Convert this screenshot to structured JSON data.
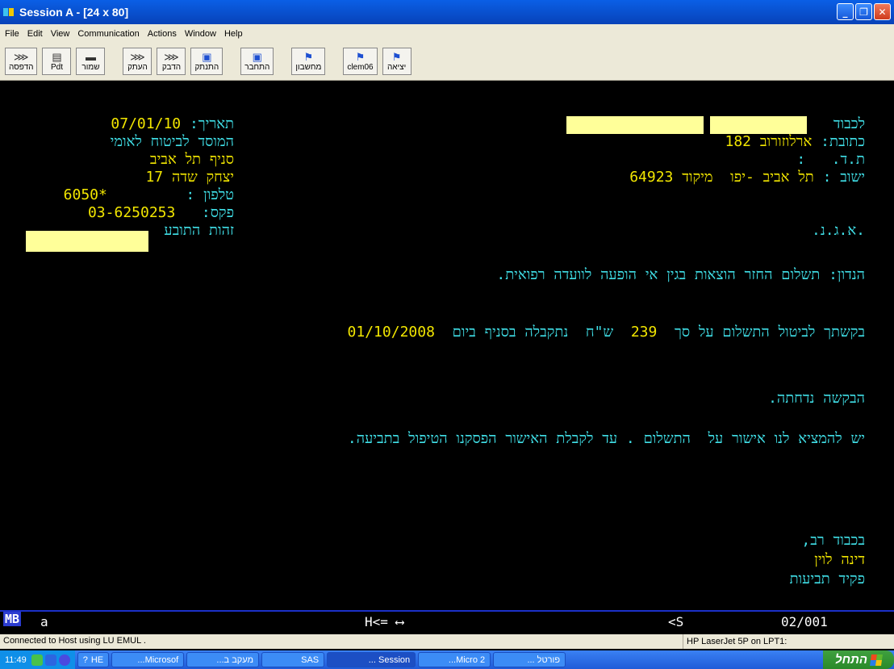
{
  "window": {
    "title": "Session A - [24 x 80]",
    "controls": {
      "minimize": "_",
      "maximize": "❐",
      "close": "✕"
    }
  },
  "menu": [
    "File",
    "Edit",
    "View",
    "Communication",
    "Actions",
    "Window",
    "Help"
  ],
  "toolbar": [
    {
      "label": "הדפסה",
      "icon": "print-screen-icon"
    },
    {
      "label": "Pdt",
      "icon": "pdt-icon"
    },
    {
      "label": "שמור",
      "icon": "save-icon"
    },
    {
      "label": "העתק",
      "icon": "copy-icon"
    },
    {
      "label": "הדבק",
      "icon": "paste-icon"
    },
    {
      "label": "התנתק",
      "icon": "disconnect-icon"
    },
    {
      "label": "התחבר",
      "icon": "connect-icon"
    },
    {
      "label": "מחשבון",
      "icon": "calculator-icon"
    },
    {
      "label": "clem06",
      "icon": "clem06-icon"
    },
    {
      "label": "יציאה",
      "icon": "exit-icon"
    }
  ],
  "letter": {
    "to_label": "לכבוד",
    "address_label": "כתובת:",
    "address_value": "ארלוזורוב 182",
    "po_box": "ת.ד.   :",
    "city_label": "ישוב :",
    "city_value": "תל אביב -יפו  מיקוד 64923",
    "ank": ".א.ג.נ.",
    "date_label": "תאריך:",
    "date_value": "07/01/10",
    "institute": "המוסד לביטוח לאומי",
    "branch": "סניף תל אביב",
    "branch_address": "יצחק שדה 17",
    "phone_label": "טלפון :",
    "phone_value": "*6050",
    "fax_label": "פקס:",
    "fax_value": "03-6250253",
    "claimant_id_label": "זהות התובע",
    "subject": "הנדון: תשלום החזר הוצאות בגין אי הופעה לוועדה רפואית.",
    "request_part1": "בקשתך לביטול התשלום על סך",
    "amount": "239",
    "request_part2": "ש\"ח  נתקבלה בסניף ביום",
    "received_date": "01/10/2008",
    "rejected": "הבקשה נדחתה.",
    "instruction": "יש להמציא לנו אישור על  התשלום . עד לקבלת האישור הפסקנו הטיפול בתביעה.",
    "closing": "בכבוד רב,",
    "signer_name": "דינה לוין",
    "signer_title": "פקיד תביעות"
  },
  "oia": {
    "mode": "MB",
    "session": "a",
    "cursor_dir": "H<= ⟷",
    "indicator": "<S",
    "position": "02/001"
  },
  "status": {
    "connection": "Connected to Host using LU EMUL   .",
    "printer": "HP LaserJet 5P on LPT1:"
  },
  "taskbar": {
    "clock": "11:49",
    "lang": "HE",
    "tasks": [
      "Microsof...",
      "מעקב ב...",
      "SAS",
      "Session ...",
      "Micro 2...",
      "פורטל ..."
    ],
    "start_label": "התחל"
  }
}
